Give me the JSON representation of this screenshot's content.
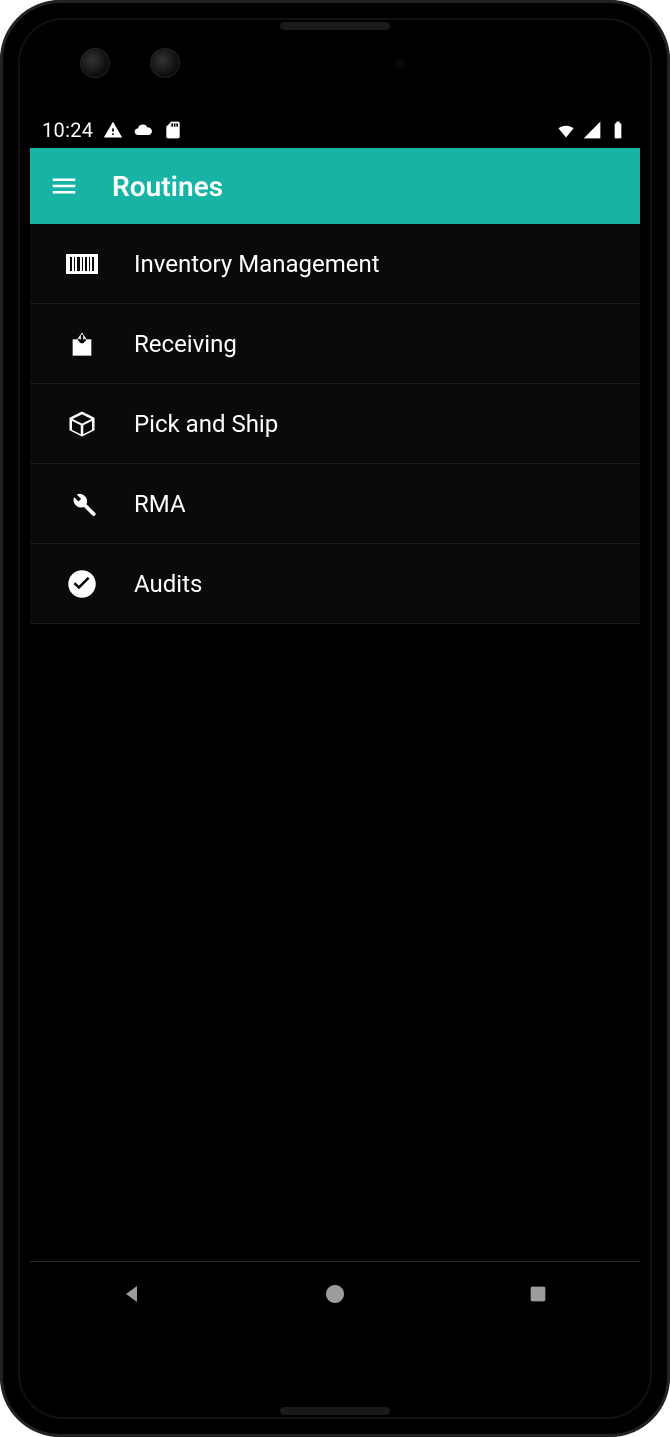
{
  "status_bar": {
    "time": "10:24",
    "left_icons": [
      "warning-icon",
      "cloud-icon",
      "sd-card-icon"
    ],
    "right_icons": [
      "wifi-icon",
      "cell-signal-icon",
      "battery-icon"
    ]
  },
  "app_bar": {
    "title": "Routines",
    "menu_icon": "hamburger-icon"
  },
  "accent_color": "#17b3a4",
  "list": {
    "items": [
      {
        "icon": "barcode-icon",
        "label": "Inventory Management"
      },
      {
        "icon": "download-box-icon",
        "label": "Receiving"
      },
      {
        "icon": "cube-icon",
        "label": "Pick and Ship"
      },
      {
        "icon": "wrench-icon",
        "label": "RMA"
      },
      {
        "icon": "check-circle-icon",
        "label": "Audits"
      }
    ]
  },
  "nav_bar": {
    "buttons": [
      "back",
      "home",
      "recent"
    ]
  }
}
